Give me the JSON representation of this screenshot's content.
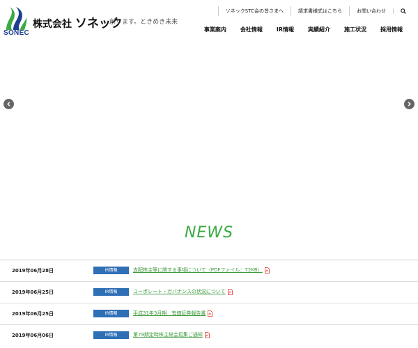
{
  "header": {
    "logo_text": "SONEC",
    "company_prefix": "株式会社",
    "company_name": "ソネック",
    "tagline": "創ります。ときめき未来",
    "util_links": [
      "ソネックSTC会の皆さまへ",
      "請求書様式はこちら",
      "お問い合わせ"
    ],
    "nav": [
      "事業案内",
      "会社情報",
      "IR情報",
      "実績紹介",
      "施工状況",
      "採用情報"
    ]
  },
  "news": {
    "title": "NEWS",
    "items": [
      {
        "date": "2019年06月28日",
        "category": "IR情報",
        "title": "支配株主等に関する事項について（PDFファイル：72KB）",
        "has_pdf": true
      },
      {
        "date": "2019年06月25日",
        "category": "IR情報",
        "title": "コーポレート・ガバナンスの状況について",
        "has_pdf": true
      },
      {
        "date": "2019年06月25日",
        "category": "IR情報",
        "title": "平成31年3月期　有価証券報告書",
        "has_pdf": true
      },
      {
        "date": "2019年06月06日",
        "category": "IR情報",
        "title": "第79期定時株主総会招集ご通知",
        "has_pdf": true
      }
    ]
  },
  "colors": {
    "brand_green": "#3caa44",
    "brand_blue": "#1d3f8f",
    "badge_blue": "#2e6fb5",
    "link_green": "#3b9a3b"
  },
  "icons": {
    "search": "search-icon",
    "pdf": "pdf-icon",
    "prev": "chevron-left-icon",
    "next": "chevron-right-icon"
  }
}
